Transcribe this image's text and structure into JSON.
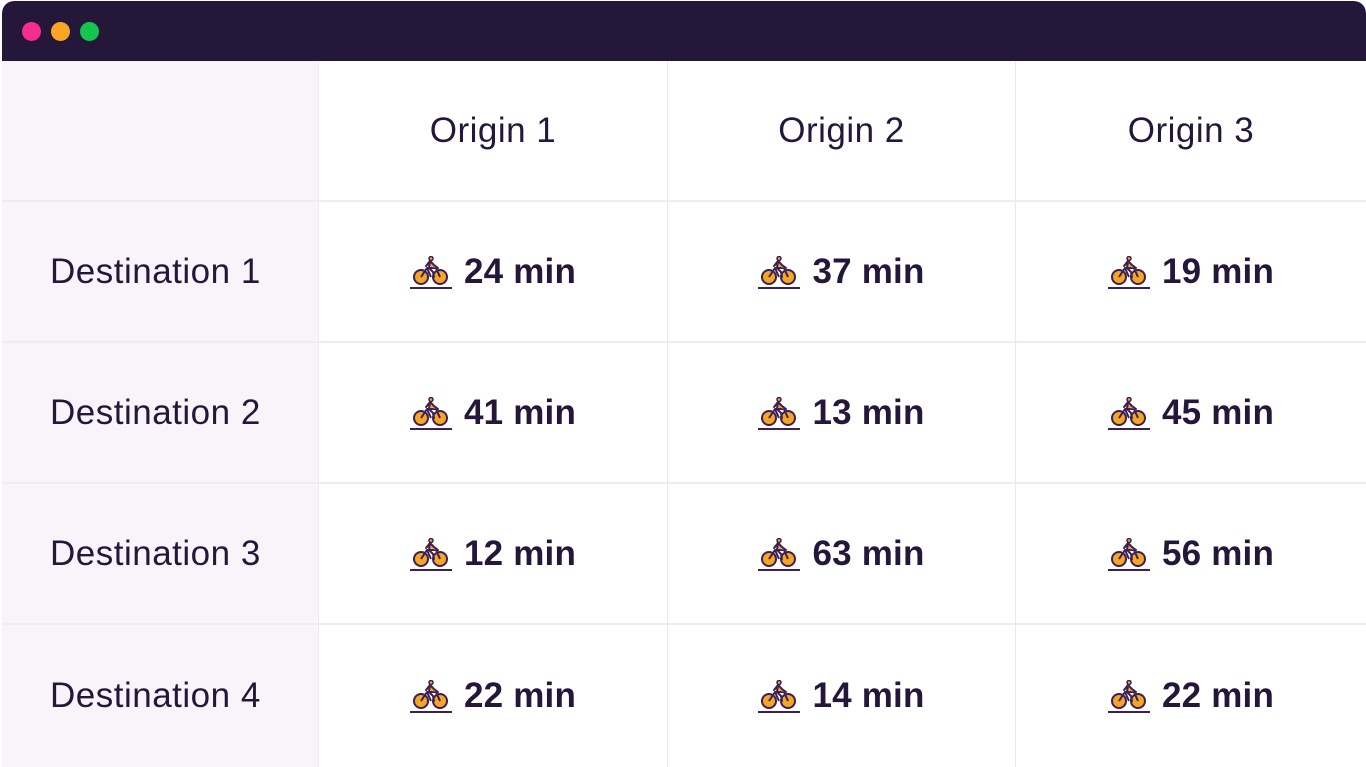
{
  "window": {
    "controls": [
      {
        "name": "close",
        "color": "#f72c8c"
      },
      {
        "name": "minimize",
        "color": "#f8a723"
      },
      {
        "name": "maximize",
        "color": "#14c650"
      }
    ],
    "titlebar_color": "#24173a"
  },
  "colors": {
    "text": "#24173a",
    "first_column_bg": "#f8f4fa",
    "icon_fill": "#f5a623",
    "icon_outline": "#3b1f57"
  },
  "table": {
    "corner_label": "",
    "origins": [
      "Origin 1",
      "Origin 2",
      "Origin 3"
    ],
    "rows": [
      {
        "destination": "Destination 1",
        "values": [
          {
            "icon": "bicycle-icon",
            "text": "24 min"
          },
          {
            "icon": "bicycle-icon",
            "text": "37 min"
          },
          {
            "icon": "bicycle-icon",
            "text": "19 min"
          }
        ]
      },
      {
        "destination": "Destination 2",
        "values": [
          {
            "icon": "bicycle-icon",
            "text": "41 min"
          },
          {
            "icon": "bicycle-icon",
            "text": "13 min"
          },
          {
            "icon": "bicycle-icon",
            "text": "45 min"
          }
        ]
      },
      {
        "destination": "Destination 3",
        "values": [
          {
            "icon": "bicycle-icon",
            "text": "12 min"
          },
          {
            "icon": "bicycle-icon",
            "text": "63 min"
          },
          {
            "icon": "bicycle-icon",
            "text": "56 min"
          }
        ]
      },
      {
        "destination": "Destination 4",
        "values": [
          {
            "icon": "bicycle-icon",
            "text": "22 min"
          },
          {
            "icon": "bicycle-icon",
            "text": "14 min"
          },
          {
            "icon": "bicycle-icon",
            "text": "22 min"
          }
        ]
      }
    ]
  }
}
